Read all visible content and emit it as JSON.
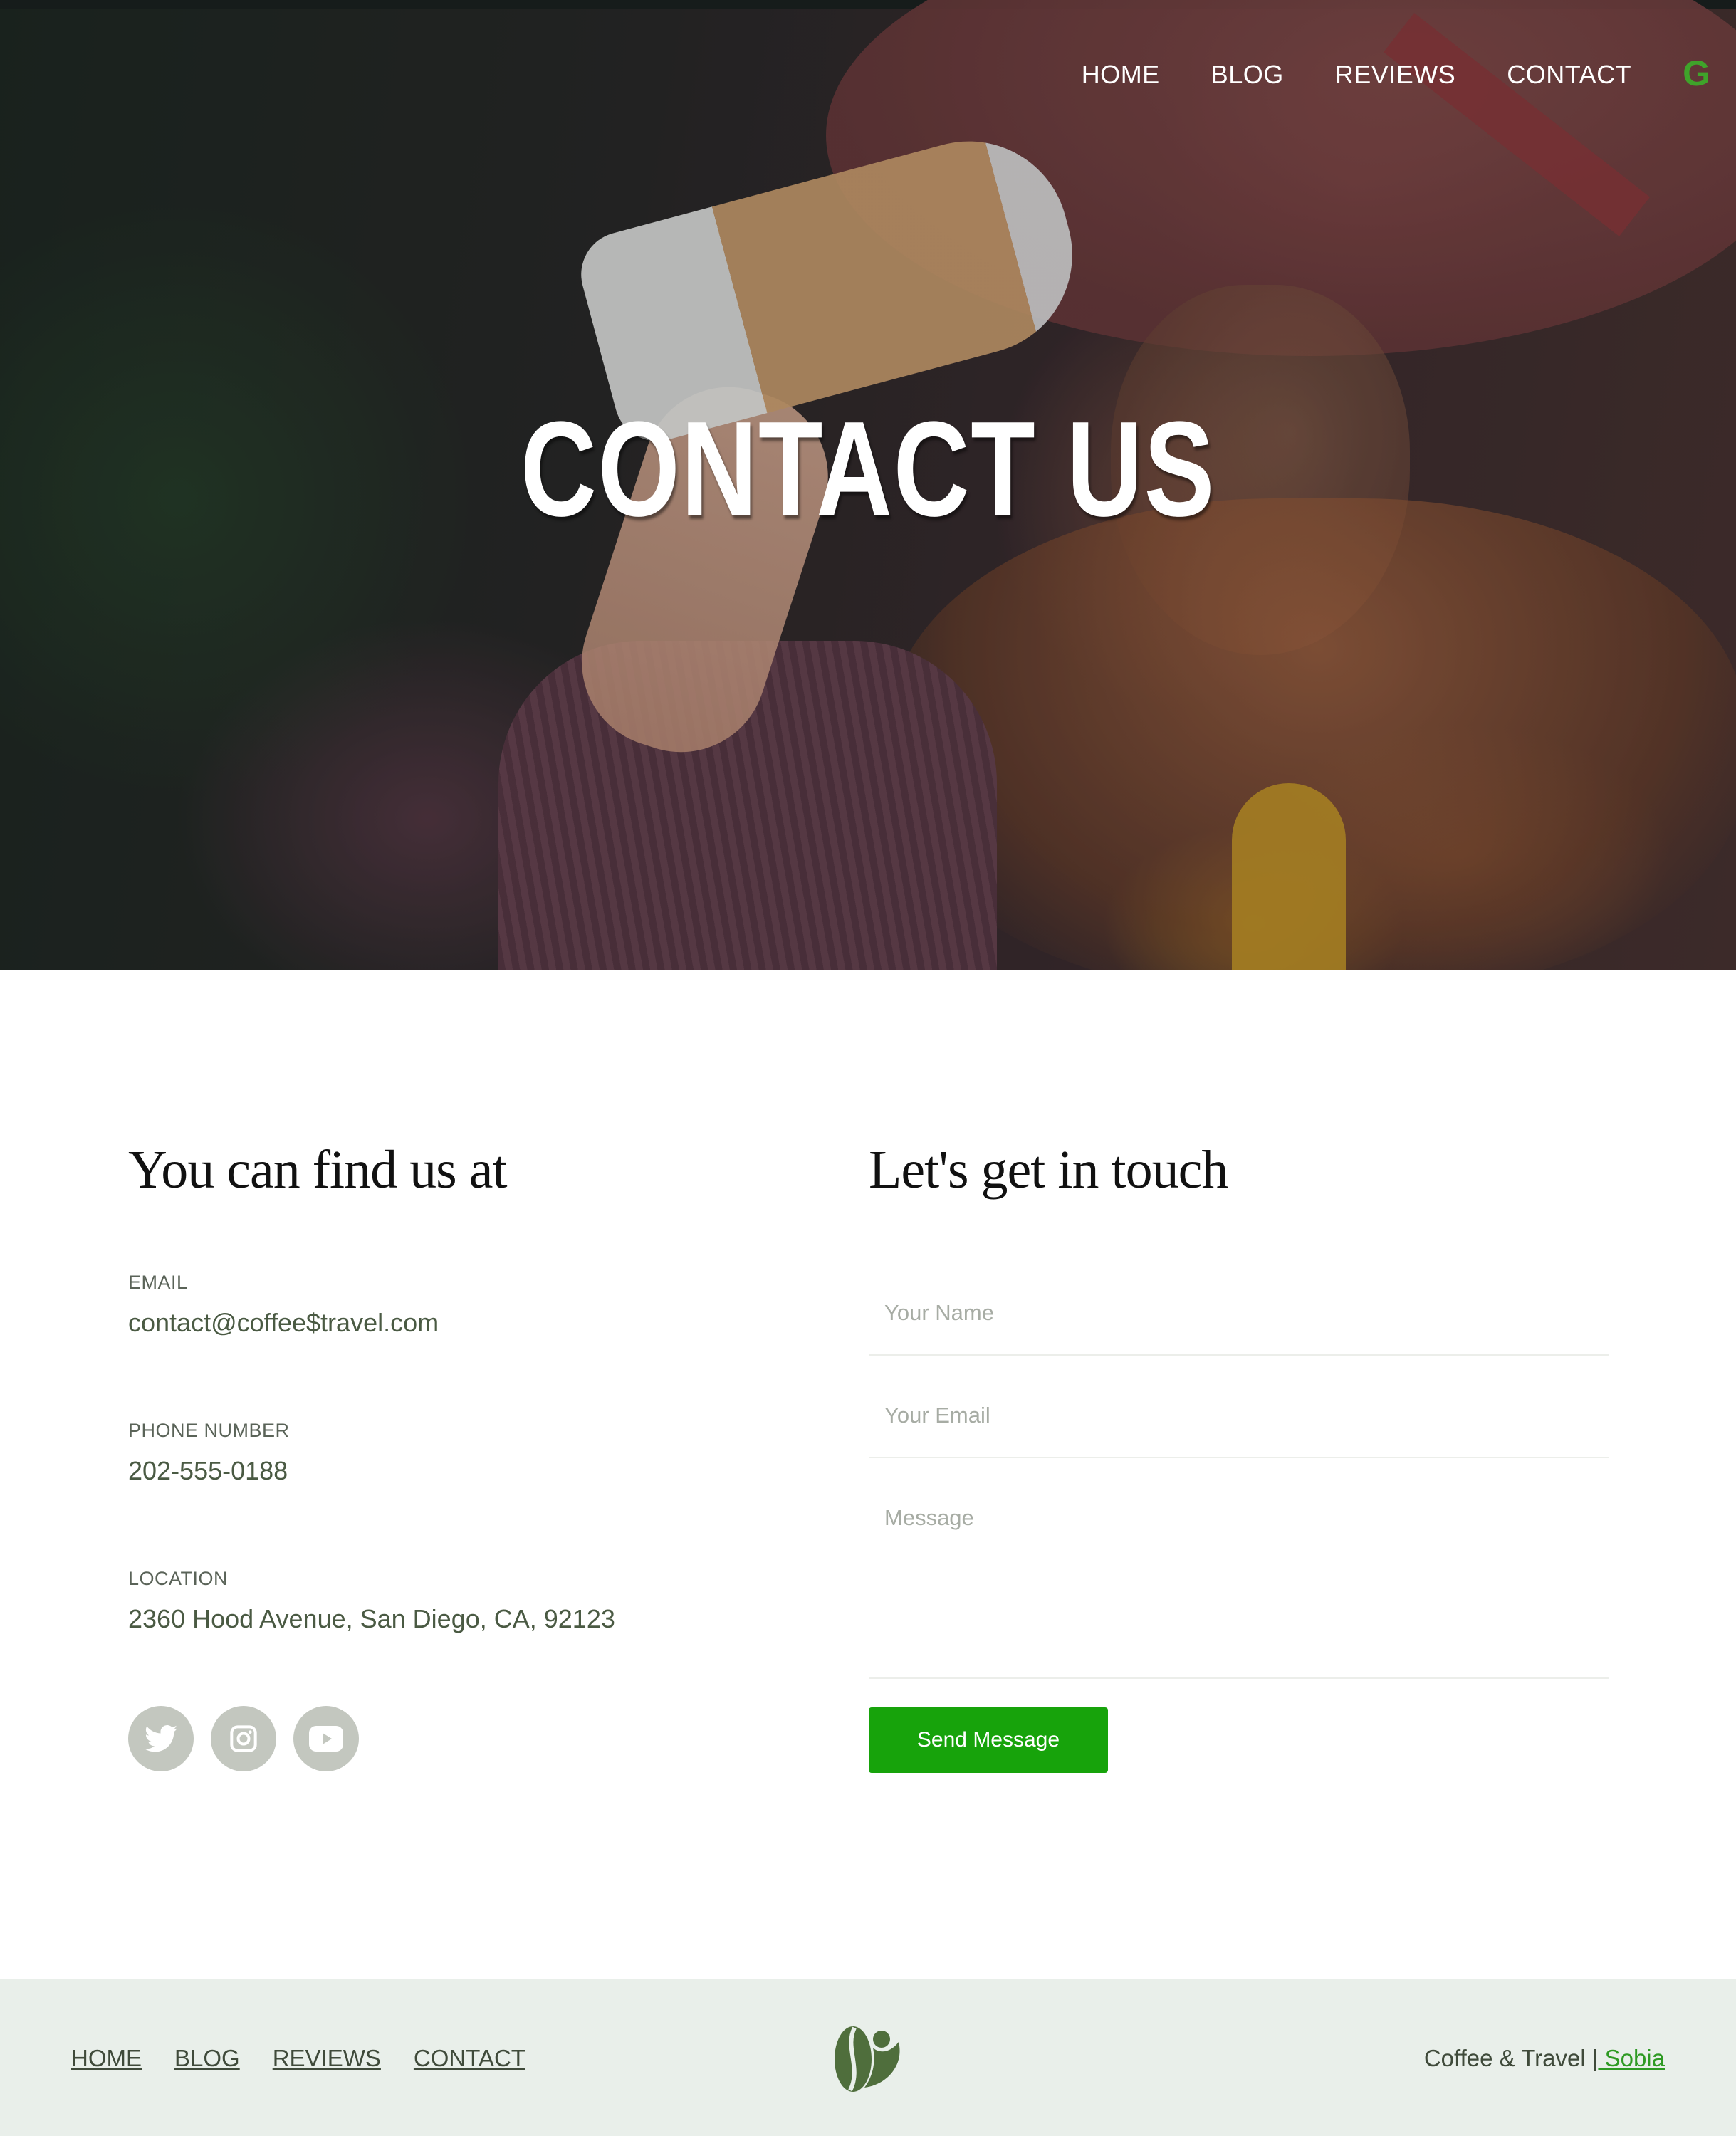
{
  "nav": {
    "items": [
      {
        "label": "HOME"
      },
      {
        "label": "BLOG"
      },
      {
        "label": "REVIEWS"
      },
      {
        "label": "CONTACT"
      }
    ],
    "logo_letter": "G",
    "logo_color": "#3fa32a"
  },
  "hero": {
    "title": "CONTACT US"
  },
  "contact_info": {
    "heading": "You can find us at",
    "email": {
      "label": "EMAIL",
      "value": "contact@coffee$travel.com"
    },
    "phone": {
      "label": "PHONE NUMBER",
      "value": "202-555-0188"
    },
    "location": {
      "label": "LOCATION",
      "value": "2360 Hood Avenue, San Diego, CA, 92123"
    },
    "socials": [
      {
        "icon": "twitter-icon"
      },
      {
        "icon": "instagram-icon"
      },
      {
        "icon": "youtube-icon"
      }
    ]
  },
  "form": {
    "heading": "Let's get in touch",
    "name_placeholder": "Your Name",
    "email_placeholder": "Your Email",
    "message_placeholder": "Message",
    "submit_label": "Send Message",
    "submit_color": "#17a30b"
  },
  "footer": {
    "links": [
      {
        "label": "HOME"
      },
      {
        "label": "BLOG"
      },
      {
        "label": "REVIEWS"
      },
      {
        "label": "CONTACT"
      }
    ],
    "logo_icon": "coffee-bean-icon",
    "credit_text": "Coffee & Travel |",
    "credit_link": " Sobia",
    "background": "#e9efea"
  }
}
